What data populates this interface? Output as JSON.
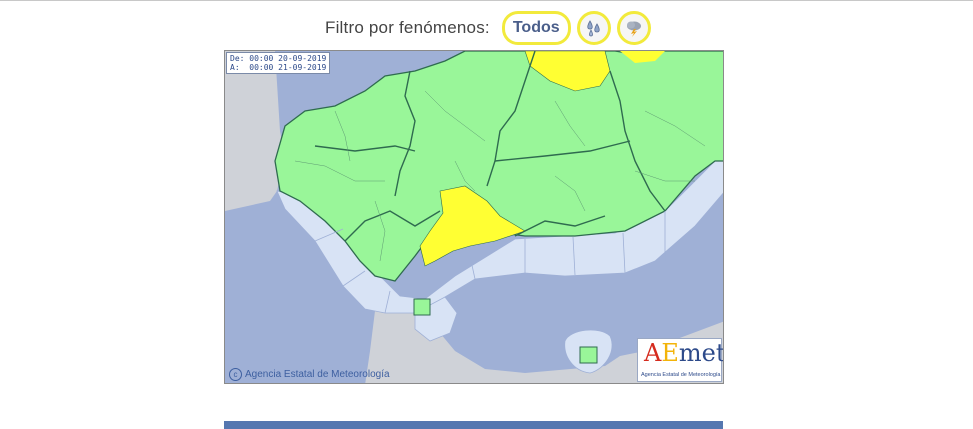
{
  "filter": {
    "label": "Filtro por fenómenos:",
    "all_label": "Todos",
    "buttons": [
      {
        "icon": "rain-drops-icon"
      },
      {
        "icon": "storm-cloud-icon"
      }
    ],
    "highlight_color": "#f2ea3c"
  },
  "map": {
    "date_from_label": "De:",
    "date_from": "00:00 20-09-2019",
    "date_to_label": "A:",
    "date_to": "00:00 21-09-2019",
    "copyright": "Agencia Estatal de Meteorología",
    "logo_text": "AEmet",
    "logo_subtitle": "Agencia Estatal de Meteorología",
    "legend_colors": {
      "no_warning": "#99f699",
      "yellow_warning": "#ffff33",
      "sea": "#d8e3f5",
      "outside": "#9fb0d6",
      "foreign_land": "#cfd2d8"
    }
  }
}
